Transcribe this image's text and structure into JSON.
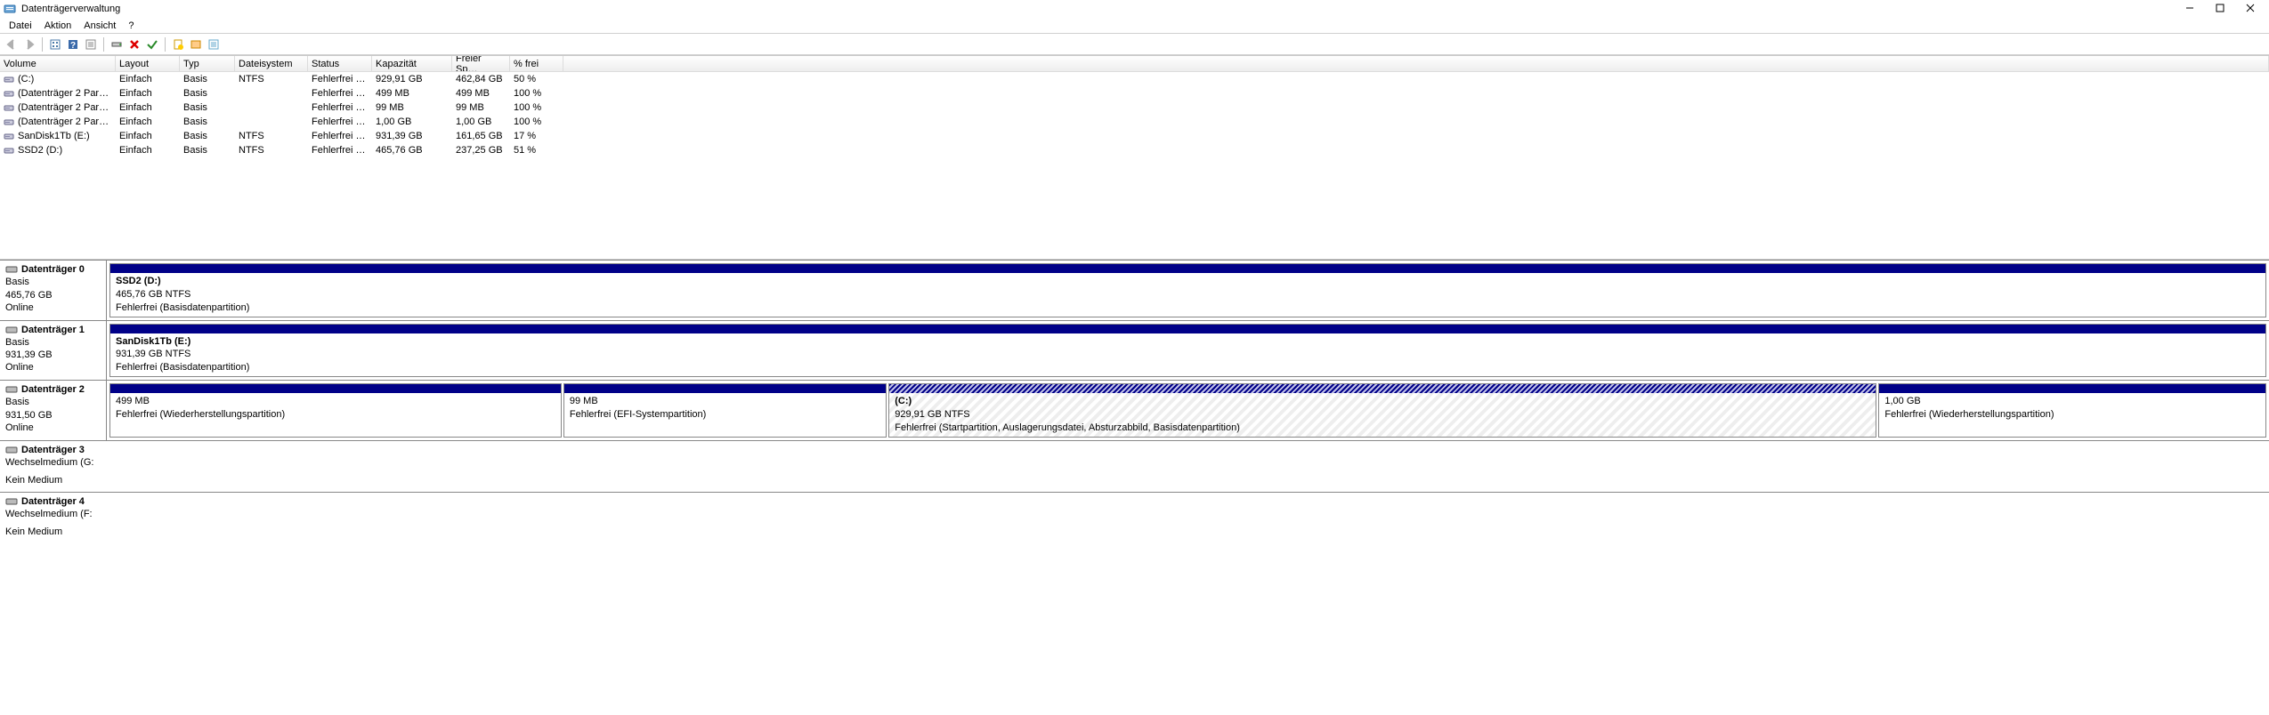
{
  "window": {
    "title": "Datenträgerverwaltung"
  },
  "menu": {
    "file": "Datei",
    "action": "Aktion",
    "view": "Ansicht",
    "help": "?"
  },
  "columns": {
    "volume": "Volume",
    "layout": "Layout",
    "typ": "Typ",
    "fs": "Dateisystem",
    "status": "Status",
    "cap": "Kapazität",
    "free": "Freier Sp…",
    "pct": "% frei"
  },
  "volumes": [
    {
      "name": "(C:)",
      "layout": "Einfach",
      "typ": "Basis",
      "fs": "NTFS",
      "status": "Fehlerfrei (…",
      "cap": "929,91 GB",
      "free": "462,84 GB",
      "pct": "50 %"
    },
    {
      "name": "(Datenträger 2 Par…",
      "layout": "Einfach",
      "typ": "Basis",
      "fs": "",
      "status": "Fehlerfrei (…",
      "cap": "499 MB",
      "free": "499 MB",
      "pct": "100 %"
    },
    {
      "name": "(Datenträger 2 Par…",
      "layout": "Einfach",
      "typ": "Basis",
      "fs": "",
      "status": "Fehlerfrei (…",
      "cap": "99 MB",
      "free": "99 MB",
      "pct": "100 %"
    },
    {
      "name": "(Datenträger 2 Par…",
      "layout": "Einfach",
      "typ": "Basis",
      "fs": "",
      "status": "Fehlerfrei (…",
      "cap": "1,00 GB",
      "free": "1,00 GB",
      "pct": "100 %"
    },
    {
      "name": "SanDisk1Tb (E:)",
      "layout": "Einfach",
      "typ": "Basis",
      "fs": "NTFS",
      "status": "Fehlerfrei (…",
      "cap": "931,39 GB",
      "free": "161,65 GB",
      "pct": "17 %"
    },
    {
      "name": "SSD2 (D:)",
      "layout": "Einfach",
      "typ": "Basis",
      "fs": "NTFS",
      "status": "Fehlerfrei (…",
      "cap": "465,76 GB",
      "free": "237,25 GB",
      "pct": "51 %"
    }
  ],
  "disks": [
    {
      "name": "Datenträger 0",
      "type": "Basis",
      "size": "465,76 GB",
      "state": "Online",
      "parts": [
        {
          "title": "SSD2  (D:)",
          "sub": "465,76 GB NTFS",
          "detail": "Fehlerfrei (Basisdatenpartition)",
          "grow": 1,
          "hatched": false
        }
      ]
    },
    {
      "name": "Datenträger 1",
      "type": "Basis",
      "size": "931,39 GB",
      "state": "Online",
      "parts": [
        {
          "title": "SanDisk1Tb  (E:)",
          "sub": "931,39 GB NTFS",
          "detail": "Fehlerfrei (Basisdatenpartition)",
          "grow": 1,
          "hatched": false
        }
      ]
    },
    {
      "name": "Datenträger 2",
      "type": "Basis",
      "size": "931,50 GB",
      "state": "Online",
      "parts": [
        {
          "title": "",
          "sub": "499 MB",
          "detail": "Fehlerfrei (Wiederherstellungspartition)",
          "grow": 0.21,
          "hatched": false
        },
        {
          "title": "",
          "sub": "99 MB",
          "detail": "Fehlerfrei (EFI-Systempartition)",
          "grow": 0.15,
          "hatched": false
        },
        {
          "title": "(C:)",
          "sub": "929,91 GB NTFS",
          "detail": "Fehlerfrei (Startpartition, Auslagerungsdatei, Absturzabbild, Basisdatenpartition)",
          "grow": 0.46,
          "hatched": true
        },
        {
          "title": "",
          "sub": "1,00 GB",
          "detail": "Fehlerfrei (Wiederherstellungspartition)",
          "grow": 0.18,
          "hatched": false
        }
      ]
    },
    {
      "name": "Datenträger 3",
      "type": "Wechselmedium (G:",
      "size": "",
      "state": "Kein Medium",
      "parts": []
    },
    {
      "name": "Datenträger 4",
      "type": "Wechselmedium (F:",
      "size": "",
      "state": "Kein Medium",
      "parts": []
    }
  ]
}
